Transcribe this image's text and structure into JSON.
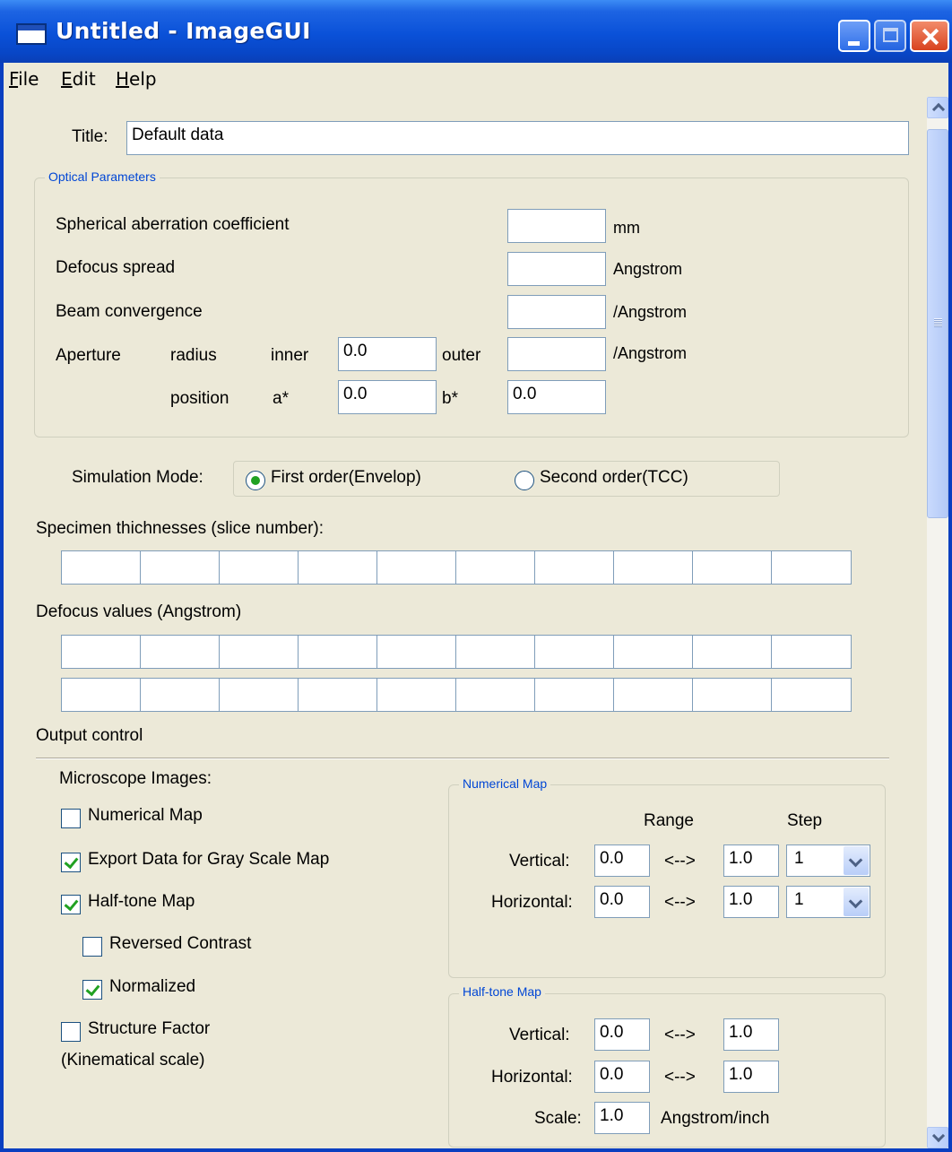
{
  "window": {
    "title": "Untitled - ImageGUI"
  },
  "menu": {
    "items": [
      "File",
      "Edit",
      "Help"
    ],
    "mnemonics": [
      "F",
      "E",
      "H"
    ]
  },
  "title_field": {
    "label": "Title:",
    "value": "Default data"
  },
  "optical": {
    "group_label": "Optical Parameters",
    "spherical_label": "Spherical aberration coefficient",
    "spherical_value": "",
    "spherical_unit": "mm",
    "defocus_label": "Defocus spread",
    "defocus_value": "",
    "defocus_unit": "Angstrom",
    "beam_label": "Beam convergence",
    "beam_value": "",
    "beam_unit": "/Angstrom",
    "aperture_label": "Aperture",
    "radius_label": "radius",
    "inner_label": "inner",
    "inner_value": "0.0",
    "outer_label": "outer",
    "outer_value": "",
    "aperture_unit": "/Angstrom",
    "position_label": "position",
    "a_label": "a*",
    "a_value": "0.0",
    "b_label": "b*",
    "b_value": "0.0"
  },
  "simulation": {
    "label": "Simulation Mode:",
    "options": [
      {
        "label": "First order(Envelop)",
        "selected": true
      },
      {
        "label": "Second order(TCC)",
        "selected": false
      }
    ]
  },
  "thickness": {
    "label": "Specimen thichnesses (slice number):",
    "values": [
      "",
      "",
      "",
      "",
      "",
      "",
      "",
      "",
      "",
      ""
    ]
  },
  "defocus_values": {
    "label": "Defocus values (Angstrom)",
    "rows": [
      [
        "",
        "",
        "",
        "",
        "",
        "",
        "",
        "",
        "",
        ""
      ],
      [
        "",
        "",
        "",
        "",
        "",
        "",
        "",
        "",
        "",
        ""
      ]
    ]
  },
  "output": {
    "label": "Output control",
    "microscope_label": "Microscope Images:",
    "checkboxes": [
      {
        "label": "Numerical Map",
        "checked": false
      },
      {
        "label": "Export Data for Gray Scale Map",
        "checked": true
      },
      {
        "label": "Half-tone Map",
        "checked": true
      },
      {
        "label": "Reversed Contrast",
        "checked": false
      },
      {
        "label": "Normalized",
        "checked": true
      },
      {
        "label": "Structure Factor",
        "checked": false
      }
    ],
    "structure_factor_sub": "(Kinematical scale)"
  },
  "numerical_map": {
    "group_label": "Numerical Map",
    "range_header": "Range",
    "step_header": "Step",
    "arrow": "<-->",
    "vertical": {
      "label": "Vertical:",
      "from": "0.0",
      "to": "1.0",
      "step": "1"
    },
    "horizontal": {
      "label": "Horizontal:",
      "from": "0.0",
      "to": "1.0",
      "step": "1"
    }
  },
  "halftone_map": {
    "group_label": "Half-tone Map",
    "arrow": "<-->",
    "vertical": {
      "label": "Vertical:",
      "from": "0.0",
      "to": "1.0"
    },
    "horizontal": {
      "label": "Horizontal:",
      "from": "0.0",
      "to": "1.0"
    },
    "scale": {
      "label": "Scale:",
      "value": "1.0",
      "unit": "Angstrom/inch"
    }
  }
}
